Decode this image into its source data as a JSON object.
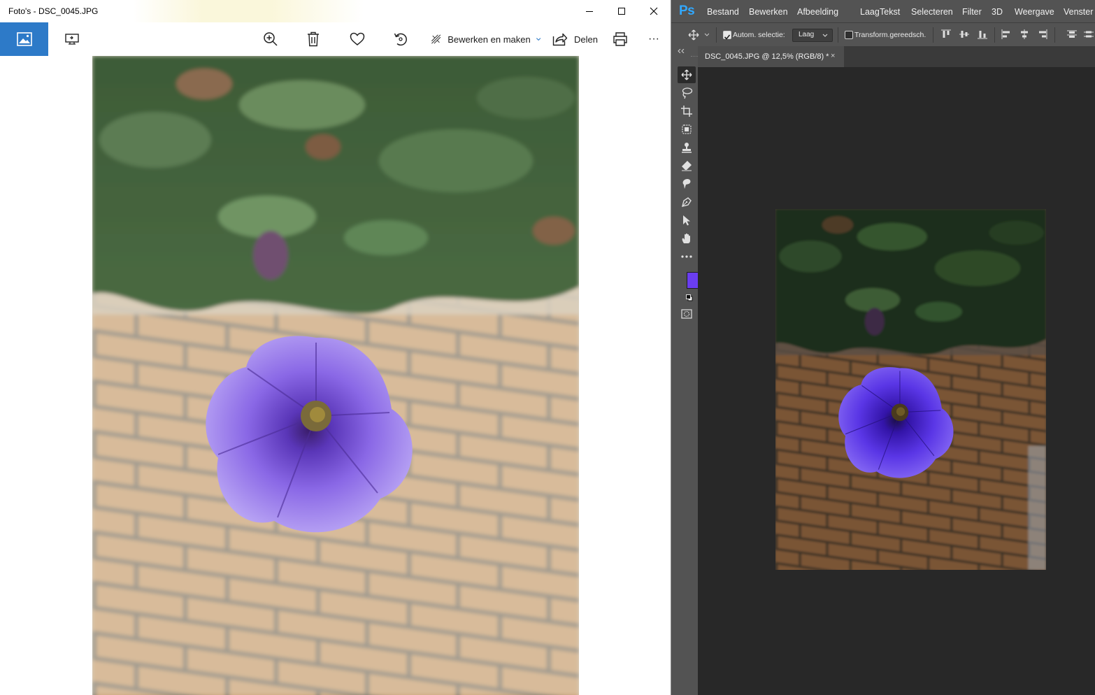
{
  "photos_app": {
    "window_title": "Foto's - DSC_0045.JPG",
    "toolbar": {
      "edit_create_label": "Bewerken en maken",
      "share_label": "Delen",
      "more_label": "···"
    }
  },
  "photoshop": {
    "logo": "Ps",
    "menu": [
      "Bestand",
      "Bewerken",
      "Afbeelding",
      "Laag",
      "Tekst",
      "Selecteren",
      "Filter",
      "3D",
      "Weergave",
      "Venster"
    ],
    "options": {
      "auto_select_label": "Autom. selectie:",
      "auto_select_target": "Laag",
      "transform_label": "Transform.gereedsch."
    },
    "document_tab": {
      "title": "DSC_0045.JPG @ 12,5% (RGB/8) *",
      "close": "×"
    },
    "colors": {
      "foreground": "#6a3df0",
      "background": "#f5e400"
    }
  }
}
